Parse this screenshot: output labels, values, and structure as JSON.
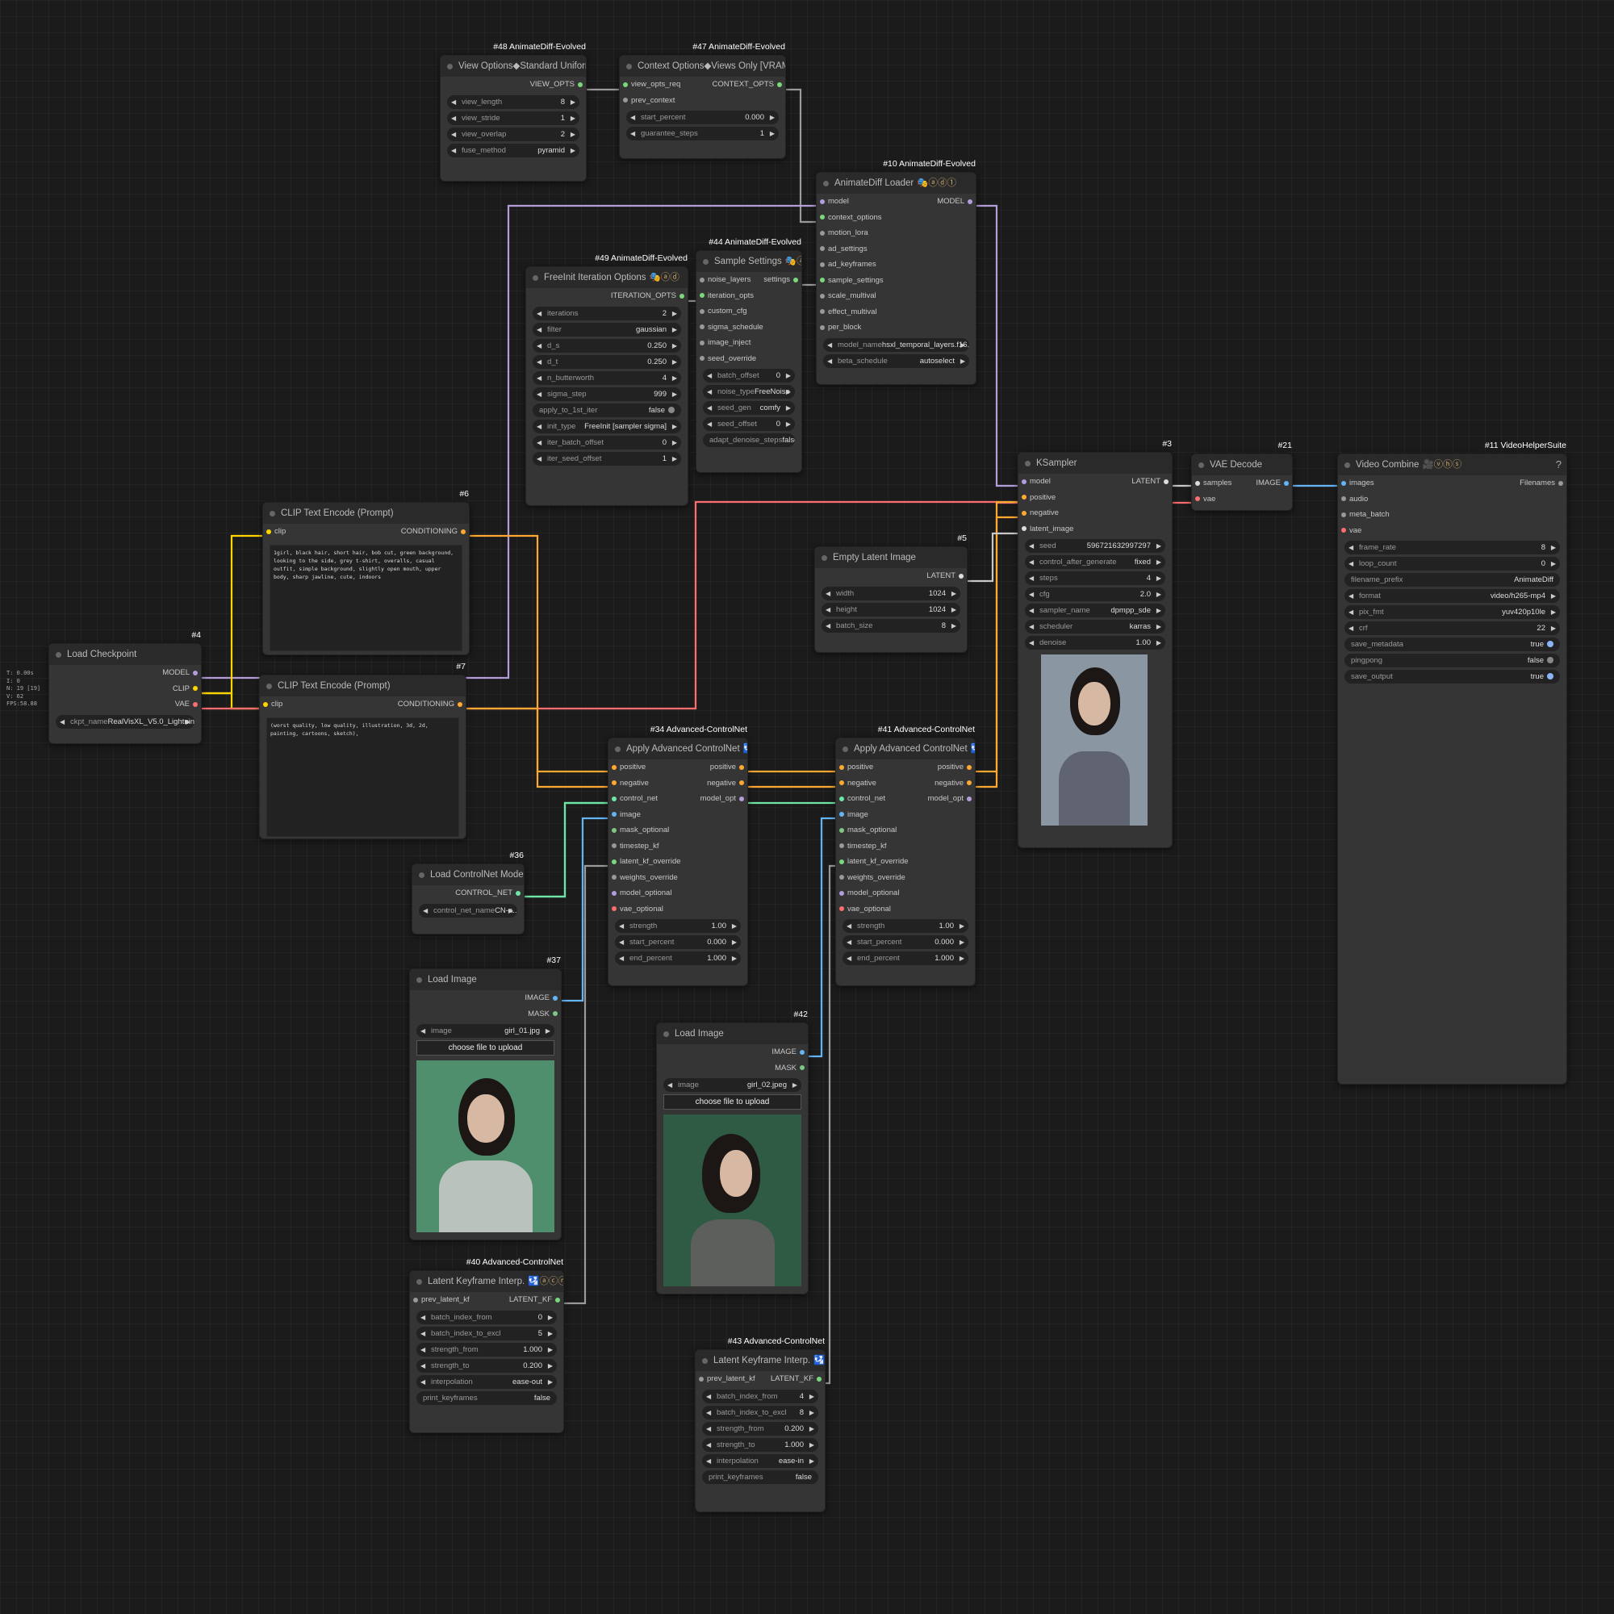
{
  "stats": {
    "t": "T: 0.00s",
    "i": "I: 0",
    "n": "N: 19 [19]",
    "v": "V: 62",
    "fps": "FPS:58.88"
  },
  "nodes": {
    "n48": {
      "badge": "#48 AnimateDiff-Evolved",
      "title": "View Options◆Standard Uniform",
      "extra": "🎭ⓐⓓ",
      "out": "VIEW_OPTS",
      "widgets": [
        [
          "view_length",
          "8"
        ],
        [
          "view_stride",
          "1"
        ],
        [
          "view_overlap",
          "2"
        ],
        [
          "fuse_method",
          "pyramid"
        ]
      ]
    },
    "n47": {
      "badge": "#47 AnimateDiff-Evolved",
      "title": "Context Options◆Views Only [VRAM⇃]",
      "extra": "🎭ⓐⓓ",
      "in1": "view_opts_req",
      "out": "CONTEXT_OPTS",
      "in2": "prev_context",
      "widgets": [
        [
          "start_percent",
          "0.000"
        ],
        [
          "guarantee_steps",
          "1"
        ]
      ]
    },
    "n10": {
      "badge": "#10 AnimateDiff-Evolved",
      "title": "AnimateDiff Loader",
      "extra": "🎭ⓐⓓ①",
      "in1": "model",
      "out": "MODEL",
      "inputs": [
        "context_options",
        "motion_lora",
        "ad_settings",
        "ad_keyframes",
        "sample_settings",
        "scale_multival",
        "effect_multival",
        "per_block"
      ],
      "widgets": [
        [
          "model_name",
          "hsxl_temporal_layers.f16.saf..."
        ],
        [
          "beta_schedule",
          "autoselect"
        ]
      ]
    },
    "n49": {
      "badge": "#49 AnimateDiff-Evolved",
      "title": "FreeInit Iteration Options",
      "extra": "🎭ⓐⓓ",
      "out": "ITERATION_OPTS",
      "widgets": [
        [
          "iterations",
          "2"
        ],
        [
          "filter",
          "gaussian"
        ],
        [
          "d_s",
          "0.250"
        ],
        [
          "d_t",
          "0.250"
        ],
        [
          "n_butterworth",
          "4"
        ],
        [
          "sigma_step",
          "999"
        ]
      ],
      "toggle": [
        "apply_to_1st_iter",
        "false"
      ],
      "widgets2": [
        [
          "init_type",
          "FreeInit [sampler sigma]"
        ],
        [
          "iter_batch_offset",
          "0"
        ],
        [
          "iter_seed_offset",
          "1"
        ]
      ]
    },
    "n44": {
      "badge": "#44 AnimateDiff-Evolved",
      "title": "Sample Settings",
      "extra": "🎭ⓐⓓ",
      "in1": "noise_layers",
      "out": "settings",
      "inputs": [
        "iteration_opts",
        "custom_cfg",
        "sigma_schedule",
        "image_inject",
        "seed_override"
      ],
      "widgets": [
        [
          "batch_offset",
          "0"
        ],
        [
          "noise_type",
          "FreeNoise"
        ],
        [
          "seed_gen",
          "comfy"
        ],
        [
          "seed_offset",
          "0"
        ]
      ],
      "toggle": [
        "adapt_denoise_steps",
        "false"
      ]
    },
    "n6": {
      "badge": "#6",
      "title": "CLIP Text Encode (Prompt)",
      "in1": "clip",
      "out": "CONDITIONING",
      "text": "1girl, black hair, short hair, bob cut, green background, looking to the side, grey t-shirt, overalls, casual outfit, simple background, slightly open mouth, upper body, sharp jawline, cute, indoors"
    },
    "n7": {
      "badge": "#7",
      "title": "CLIP Text Encode (Prompt)",
      "in1": "clip",
      "out": "CONDITIONING",
      "text": "(worst quality, low quality, illustration, 3d, 2d, painting, cartoons, sketch),"
    },
    "n4": {
      "badge": "#4",
      "title": "Load Checkpoint",
      "outs": [
        "MODEL",
        "CLIP",
        "VAE"
      ],
      "widgets": [
        [
          "ckpt_name",
          "RealVisXL_V5.0_Lightning_f..."
        ]
      ]
    },
    "n5": {
      "badge": "#5",
      "title": "Empty Latent Image",
      "out": "LATENT",
      "widgets": [
        [
          "width",
          "1024"
        ],
        [
          "height",
          "1024"
        ],
        [
          "batch_size",
          "8"
        ]
      ]
    },
    "n3": {
      "badge": "#3",
      "title": "KSampler",
      "in1": "model",
      "out": "LATENT",
      "inputs": [
        "positive",
        "negative",
        "latent_image"
      ],
      "widgets": [
        [
          "seed",
          "596721632997297"
        ],
        [
          "control_after_generate",
          "fixed"
        ],
        [
          "steps",
          "4"
        ],
        [
          "cfg",
          "2.0"
        ],
        [
          "sampler_name",
          "dpmpp_sde"
        ],
        [
          "scheduler",
          "karras"
        ],
        [
          "denoise",
          "1.00"
        ]
      ]
    },
    "n21": {
      "badge": "#21",
      "title": "VAE Decode",
      "in1": "samples",
      "out": "IMAGE",
      "in2": "vae"
    },
    "n11": {
      "badge": "#11 VideoHelperSuite",
      "title": "Video Combine",
      "extra": "🎥ⓥⓗⓢ",
      "help": "?",
      "in1": "images",
      "out": "Filenames",
      "inputs": [
        "audio",
        "meta_batch",
        "vae"
      ],
      "widgets": [
        [
          "frame_rate",
          "8"
        ],
        [
          "loop_count",
          "0"
        ]
      ],
      "plain": [
        "filename_prefix",
        "AnimateDiff"
      ],
      "widgets2": [
        [
          "format",
          "video/h265-mp4"
        ],
        [
          "pix_fmt",
          "yuv420p10le"
        ],
        [
          "crf",
          "22"
        ]
      ],
      "toggles": [
        [
          "save_metadata",
          "true"
        ],
        [
          "pingpong",
          "false"
        ],
        [
          "save_output",
          "true"
        ]
      ]
    },
    "n34": {
      "badge": "#34 Advanced-ControlNet",
      "title": "Apply Advanced ControlNet",
      "extra": "🛂ⓐⓒⓝ",
      "pairs": [
        [
          "positive",
          "positive"
        ],
        [
          "negative",
          "negative"
        ],
        [
          "control_net",
          "model_opt"
        ]
      ],
      "inputs": [
        "image",
        "mask_optional",
        "timestep_kf",
        "latent_kf_override",
        "weights_override",
        "model_optional",
        "vae_optional"
      ],
      "widgets": [
        [
          "strength",
          "1.00"
        ],
        [
          "start_percent",
          "0.000"
        ],
        [
          "end_percent",
          "1.000"
        ]
      ]
    },
    "n41": {
      "badge": "#41 Advanced-ControlNet",
      "title": "Apply Advanced ControlNet",
      "extra": "🛂ⓐⓒⓝ",
      "pairs": [
        [
          "positive",
          "positive"
        ],
        [
          "negative",
          "negative"
        ],
        [
          "control_net",
          "model_opt"
        ]
      ],
      "inputs": [
        "image",
        "mask_optional",
        "timestep_kf",
        "latent_kf_override",
        "weights_override",
        "model_optional",
        "vae_optional"
      ],
      "widgets": [
        [
          "strength",
          "1.00"
        ],
        [
          "start_percent",
          "0.000"
        ],
        [
          "end_percent",
          "1.000"
        ]
      ]
    },
    "n36": {
      "badge": "#36",
      "title": "Load ControlNet Model",
      "out": "CONTROL_NET",
      "widgets": [
        [
          "control_net_name",
          "CN-a..."
        ]
      ]
    },
    "n37": {
      "badge": "#37",
      "title": "Load Image",
      "outs": [
        "IMAGE",
        "MASK"
      ],
      "widgets": [
        [
          "image",
          "girl_01.jpg"
        ]
      ],
      "button": "choose file to upload"
    },
    "n42": {
      "badge": "#42",
      "title": "Load Image",
      "outs": [
        "IMAGE",
        "MASK"
      ],
      "widgets": [
        [
          "image",
          "girl_02.jpeg"
        ]
      ],
      "button": "choose file to upload"
    },
    "n40": {
      "badge": "#40 Advanced-ControlNet",
      "title": "Latent Keyframe Interp.",
      "extra": "🛂ⓐⓒⓝ",
      "in1": "prev_latent_kf",
      "out": "LATENT_KF",
      "widgets": [
        [
          "batch_index_from",
          "0"
        ],
        [
          "batch_index_to_excl",
          "5"
        ],
        [
          "strength_from",
          "1.000"
        ],
        [
          "strength_to",
          "0.200"
        ],
        [
          "interpolation",
          "ease-out"
        ]
      ],
      "toggle": [
        "print_keyframes",
        "false"
      ]
    },
    "n43": {
      "badge": "#43 Advanced-ControlNet",
      "title": "Latent Keyframe Interp.",
      "extra": "🛂ⓐⓒⓝ",
      "in1": "prev_latent_kf",
      "out": "LATENT_KF",
      "widgets": [
        [
          "batch_index_from",
          "4"
        ],
        [
          "batch_index_to_excl",
          "8"
        ],
        [
          "strength_from",
          "0.200"
        ],
        [
          "strength_to",
          "1.000"
        ],
        [
          "interpolation",
          "ease-in"
        ]
      ],
      "toggle": [
        "print_keyframes",
        "false"
      ]
    }
  },
  "colors": {
    "model": "#b39ddb",
    "clip": "#ffd500",
    "vae": "#ff6e6e",
    "conditioning": "#ffa931",
    "latent": "#ff9cf9",
    "image": "#64b5f6",
    "control_net": "#6ee7a6",
    "generic": "#a0a0a0"
  }
}
